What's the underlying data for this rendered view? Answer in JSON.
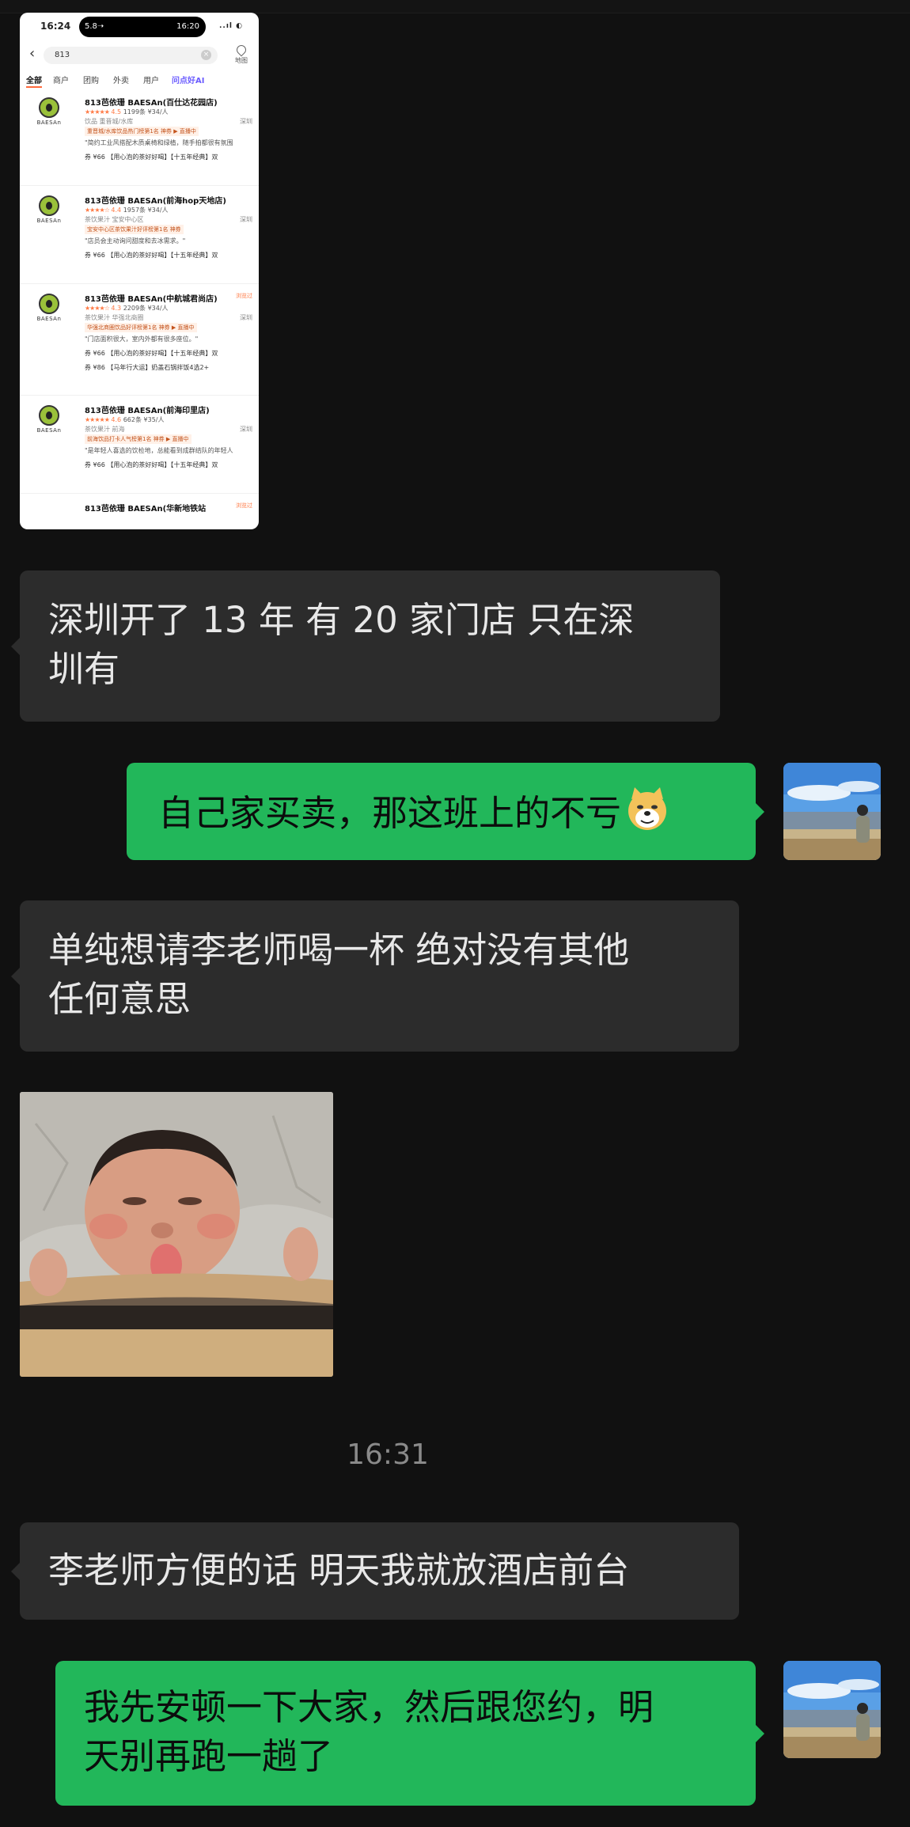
{
  "shared_screenshot": {
    "status_bar": {
      "time": "16:24",
      "island_left": "5.8➝",
      "island_right": "16:20",
      "icons": "..ıl ◐"
    },
    "search": {
      "query": "813",
      "map_label": "地图"
    },
    "tabs": [
      "全部",
      "商户",
      "团购",
      "外卖",
      "用户",
      "问点好AI"
    ],
    "stores": [
      {
        "name": "813芭依珊 BAESAn(百仕达花园店)",
        "score": "4.5",
        "reviews": "1199条",
        "price": "¥34/人",
        "category": "饮品  重晋城/水库",
        "city": "深圳",
        "badge": "重晋城/水库饮品热门榜第1名   神券   ▶ 直播中",
        "quote": "\"简约工业风搭配木质桌椅和绿植，随手拍都很有氛围",
        "deals": [
          "券 ¥66 【用心泡的茶好好喝】【十五年经典】双"
        ]
      },
      {
        "name": "813芭依珊 BAESAn(前海hop天地店)",
        "score": "4.4",
        "reviews": "1957条",
        "price": "¥34/人",
        "category": "茶饮果汁  宝安中心区",
        "city": "深圳",
        "badge": "宝安中心区茶饮果汁好评榜第1名   神券",
        "quote": "\"店员会主动询问甜度和去冰需求。\"",
        "deals": [
          "券 ¥66 【用心泡的茶好好喝】【十五年经典】双"
        ]
      },
      {
        "name": "813芭依珊 BAESAn(中航城君尚店)",
        "score": "4.3",
        "reviews": "2209条",
        "price": "¥34/人",
        "category": "茶饮果汁  华强北商圈",
        "city": "深圳",
        "badge": "华强北商圈饮品好评榜第1名   神券   ▶ 直播中",
        "quote": "\"门店面积很大，室内外都有很多座位。\"",
        "deals": [
          "券 ¥66 【用心泡的茶好好喝】【十五年经典】双",
          "券 ¥86 【马年行大运】奶盖石锅拌饭4选2+"
        ],
        "tag": "浏览过"
      },
      {
        "name": "813芭依珊 BAESAn(前海印里店)",
        "score": "4.6",
        "reviews": "662条",
        "price": "¥35/人",
        "category": "茶饮果汁  前海",
        "city": "深圳",
        "badge": "前海饮品打卡人气榜第1名   神券   ▶ 直播中",
        "quote": "\"是年轻人喜选的饮检地，总能看到成群结队的年轻人",
        "deals": [
          "券 ¥66 【用心泡的茶好好喝】【十五年经典】双"
        ]
      },
      {
        "name": "813芭依珊 BAESAn(华新地铁站",
        "tag": "浏览过"
      }
    ]
  },
  "chat": {
    "msg1_lines": [
      "深圳开了 13 年 有 20 家门店  只在深",
      "圳有"
    ],
    "msg2": "自己家买卖，那这班上的不亏",
    "msg3_lines": [
      "单纯想请李老师喝一杯  绝对没有其他",
      "任何意思"
    ],
    "timestamp": "16:31",
    "msg4": "李老师方便的话 明天我就放酒店前台",
    "msg5_lines": [
      "我先安顿一下大家，然后跟您约，明",
      "天别再跑一趟了"
    ]
  }
}
